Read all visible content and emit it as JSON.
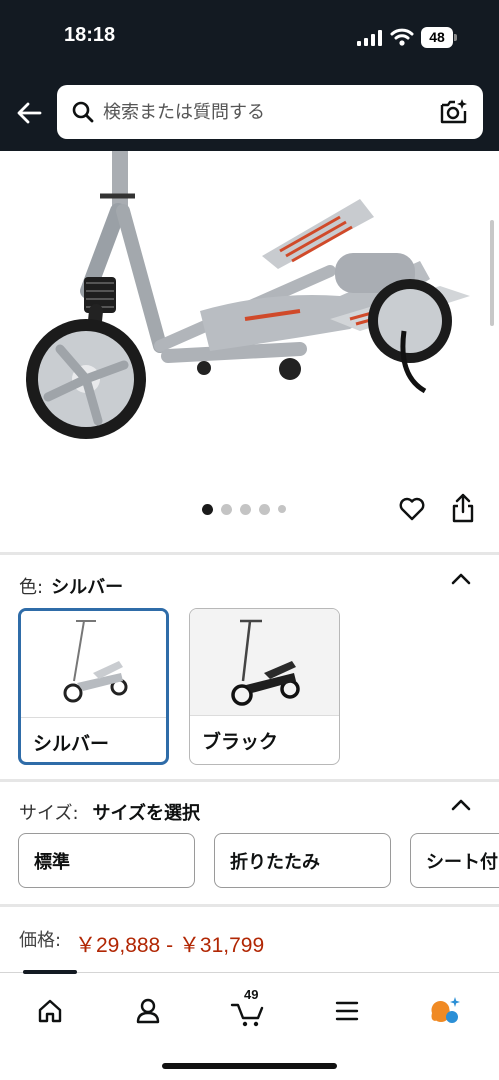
{
  "status_bar": {
    "time": "18:18",
    "battery": "48"
  },
  "search": {
    "placeholder": "検索または質問する"
  },
  "image_gallery": {
    "total_images": 5,
    "current_index": 1
  },
  "color_section": {
    "label": "色:",
    "selected": "シルバー",
    "options": [
      {
        "label": "シルバー",
        "selected": true
      },
      {
        "label": "ブラック",
        "selected": false
      }
    ]
  },
  "size_section": {
    "label": "サイズ:",
    "selected": "サイズを選択",
    "options": [
      "標準",
      "折りたたみ",
      "シート付"
    ]
  },
  "price": {
    "label": "価格:",
    "value": "￥29,888 - ￥31,799"
  },
  "bottom_nav": {
    "cart_count": "49"
  },
  "colors": {
    "header_bg": "#131a22",
    "price": "#b12704",
    "selected_border": "#2f6ca8"
  }
}
